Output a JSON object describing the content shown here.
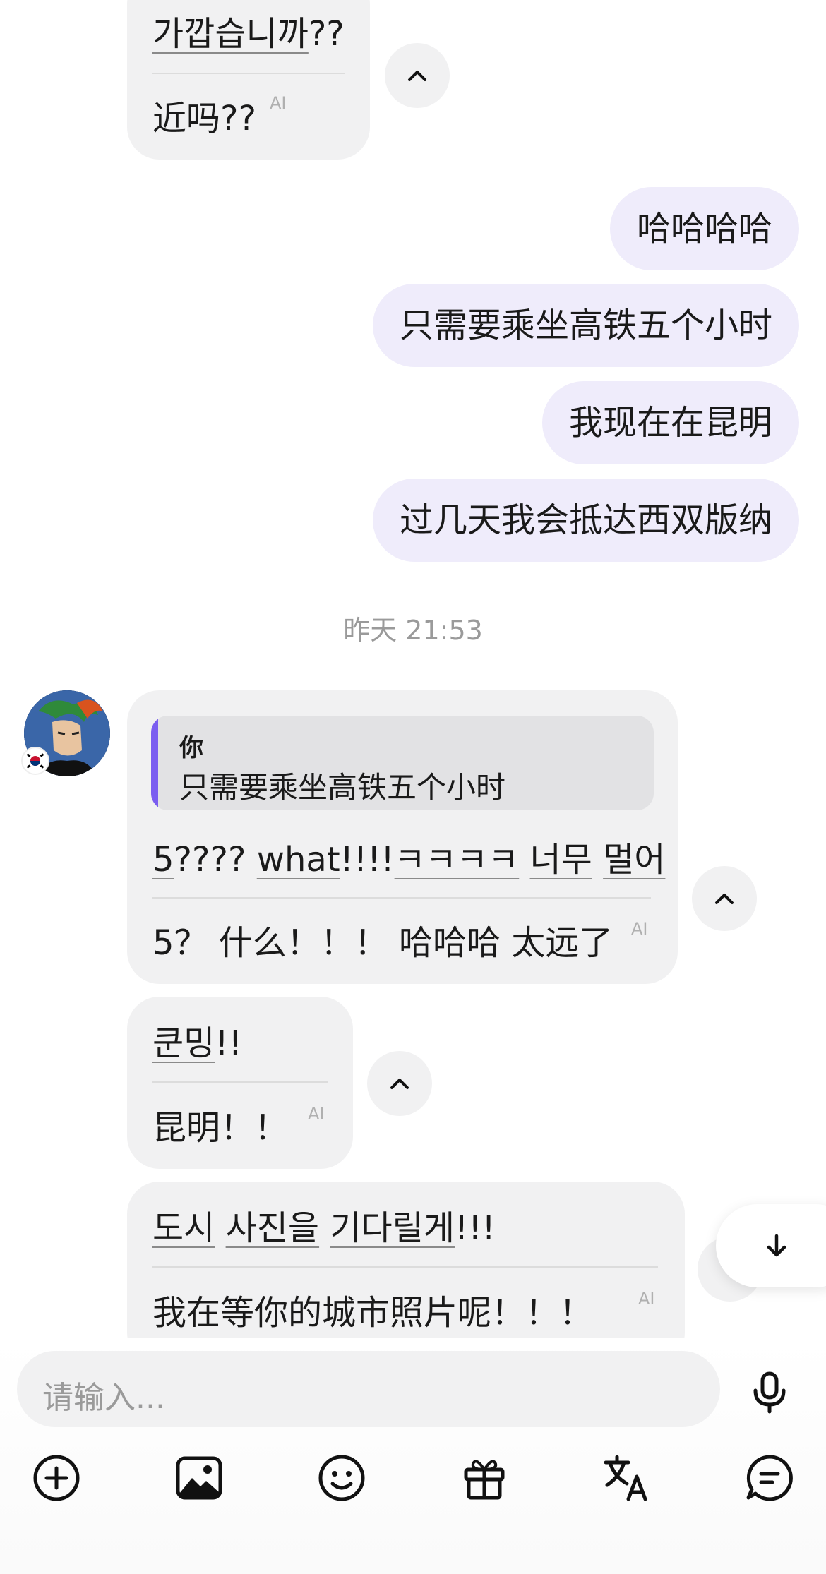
{
  "messages_top": {
    "incoming_1": {
      "original_parts": [
        "가깝습니까",
        "??"
      ],
      "translation": "近吗??",
      "ai_label": "AI"
    },
    "outgoing": [
      "哈哈哈哈",
      "只需要乘坐高铁五个小时",
      "我现在在昆明",
      "过几天我会抵达西双版纳"
    ]
  },
  "timestamp": "昨天 21:53",
  "incoming_2": {
    "quote_sender": "你",
    "quote_text": "只需要乘坐高铁五个小时",
    "original_parts": [
      "5",
      "????",
      "what",
      "!!!!",
      "ㅋㅋㅋㅋ",
      " ",
      "너무",
      " ",
      "멀어"
    ],
    "translation": "5？ 什么！！！ 哈哈哈 太远了",
    "ai_label": "AI"
  },
  "incoming_3": {
    "original_parts": [
      "쿤밍",
      "!!"
    ],
    "translation": "昆明！！",
    "ai_label": "AI"
  },
  "incoming_4": {
    "original_parts": [
      "도시",
      " ",
      "사진을",
      " ",
      "기다릴게",
      "!!!"
    ],
    "translation": "我在等你的城市照片呢！！！",
    "ai_label": "AI"
  },
  "input": {
    "placeholder": "请输入..."
  },
  "icons": {
    "collapse": "chevron-up-icon",
    "scroll_down": "arrow-down-icon",
    "mic": "microphone-icon",
    "toolbar": [
      "plus-circle-icon",
      "image-icon",
      "smiley-icon",
      "gift-icon",
      "translate-icon",
      "chat-bubble-icon"
    ]
  },
  "colors": {
    "incoming_bubble": "#f1f1f2",
    "outgoing_bubble": "#efecfb",
    "quote_bar": "#7b5ef0"
  }
}
